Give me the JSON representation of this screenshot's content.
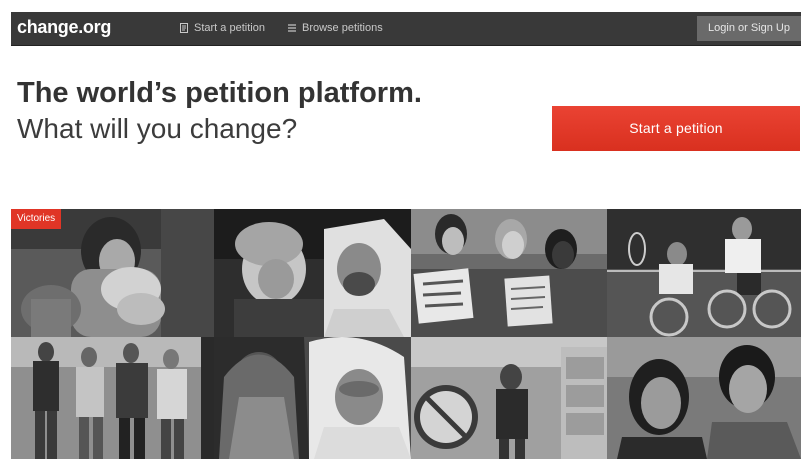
{
  "nav": {
    "logo": "change.org",
    "start_petition": "Start a petition",
    "browse_petitions": "Browse petitions",
    "login": "Login or Sign Up"
  },
  "hero": {
    "title": "The world’s petition platform.",
    "subtitle": "What will you change?",
    "cta": "Start a petition"
  },
  "gallery": {
    "badge": "Victories",
    "tiles": [
      {
        "icon": "boxer-photo"
      },
      {
        "icon": "politicians-photo"
      },
      {
        "icon": "protest-signs-photo"
      },
      {
        "icon": "wheelchair-tennis-photo"
      },
      {
        "icon": "marchers-photo"
      },
      {
        "icon": "women-headscarf-photo"
      },
      {
        "icon": "protest-crowd-photo"
      },
      {
        "icon": "two-women-photo"
      }
    ]
  },
  "colors": {
    "nav_bg": "#393939",
    "cta_red": "#e33a2a",
    "badge_red": "#e03526"
  }
}
